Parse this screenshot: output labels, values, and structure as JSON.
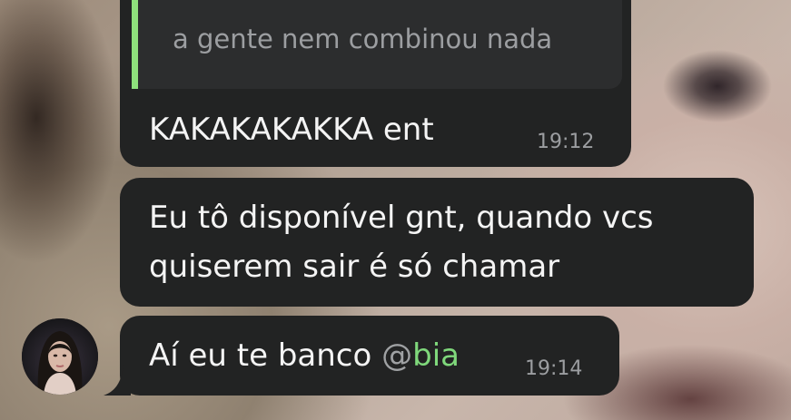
{
  "chat": {
    "messages": [
      {
        "reply_preview": "a gente nem combinou nada",
        "text": "KAKAKAKAKKA ent",
        "time": "19:12"
      },
      {
        "text_line1": "Eu tô disponível gnt, quando vcs",
        "text_line2": "quiserem sair é só chamar"
      },
      {
        "text_prefix": "Aí eu te banco ",
        "mention_at": "@",
        "mention_name": "bia",
        "time": "19:14"
      }
    ]
  },
  "colors": {
    "bubble": "#222323",
    "reply_accent": "#8ee07c",
    "mention": "#7fd87b",
    "timestamp": "#9c9ea1"
  },
  "icons": {
    "avatar": "user-avatar-photo"
  }
}
